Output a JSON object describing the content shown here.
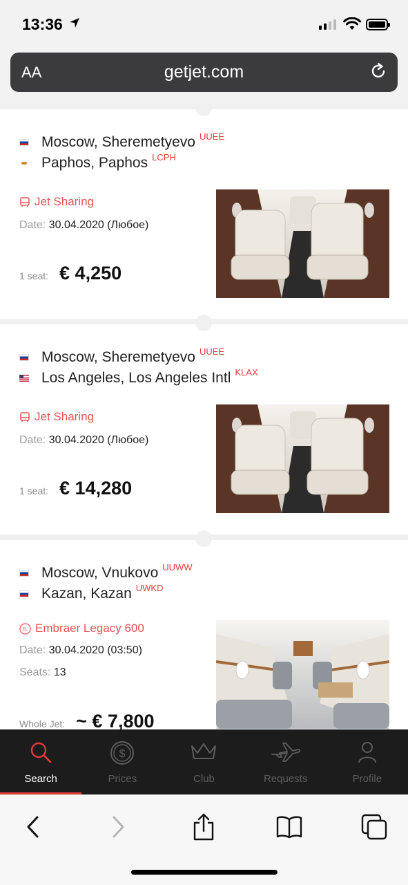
{
  "status": {
    "time": "13:36"
  },
  "browser": {
    "domain": "getjet.com",
    "text_size_label": "AA"
  },
  "listings": [
    {
      "from": {
        "name": "Moscow, Sheremetyevo",
        "code": "UUEE",
        "flag": "ru"
      },
      "to": {
        "name": "Paphos, Paphos",
        "code": "LCPH",
        "flag": "cy"
      },
      "tag": "Jet Sharing",
      "date_label": "Date:",
      "date": "30.04.2020 (Любое)",
      "price_label": "1 seat:",
      "price": "€ 4,250"
    },
    {
      "from": {
        "name": "Moscow, Sheremetyevo",
        "code": "UUEE",
        "flag": "ru"
      },
      "to": {
        "name": "Los Angeles, Los Angeles Intl",
        "code": "KLAX",
        "flag": "us"
      },
      "tag": "Jet Sharing",
      "date_label": "Date:",
      "date": "30.04.2020 (Любое)",
      "price_label": "1 seat:",
      "price": "€ 14,280"
    },
    {
      "from": {
        "name": "Moscow, Vnukovo",
        "code": "UUWW",
        "flag": "ru"
      },
      "to": {
        "name": "Kazan, Kazan",
        "code": "UWKD",
        "flag": "ru"
      },
      "tag": "Embraer Legacy 600",
      "date_label": "Date:",
      "date": "30.04.2020 (03:50)",
      "seats_label": "Seats:",
      "seats": "13",
      "price_label": "Whole Jet:",
      "price": "~ € 7,800"
    }
  ],
  "tabs": [
    {
      "label": "Search",
      "icon": "search-icon",
      "active": true
    },
    {
      "label": "Prices",
      "icon": "dollar-coin-icon",
      "active": false
    },
    {
      "label": "Club",
      "icon": "crown-icon",
      "active": false
    },
    {
      "label": "Requests",
      "icon": "airplane-icon",
      "active": false
    },
    {
      "label": "Profile",
      "icon": "person-icon",
      "active": false
    }
  ],
  "colors": {
    "accent": "#e23b3b",
    "tab_bar": "#1c1c1c",
    "url_bar": "#3b3b3d"
  }
}
